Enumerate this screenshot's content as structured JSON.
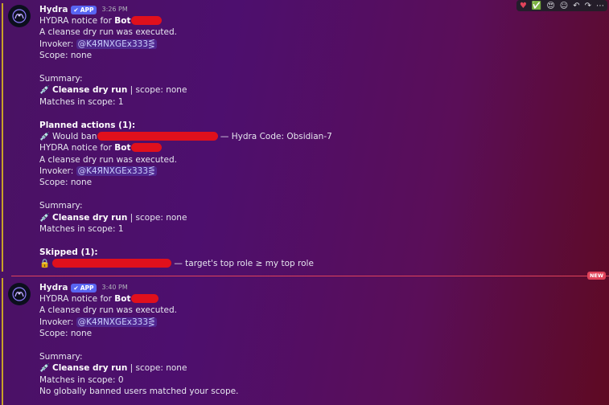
{
  "toolbar": {
    "icons": [
      "heart-icon",
      "check-icon",
      "heart-eyes-icon",
      "add-reaction-icon",
      "reply-icon",
      "forward-icon",
      "more-icon"
    ],
    "glyphs": [
      "♥",
      "✅",
      "😍",
      "☺",
      "↶",
      "↷",
      "⋯"
    ]
  },
  "messages": [
    {
      "author": "Hydra",
      "app_tag": "APP",
      "timestamp": "3:26 PM",
      "lines": {
        "notice": "HYDRA notice for ",
        "bot": "Bot",
        "executed": "A cleanse dry run was executed.",
        "invoker_label": "Invoker: ",
        "invoker": "@K4ЯNXGEx333⋚",
        "scope": "Scope: none",
        "summary": "Summary:",
        "run_bold": "Cleanse dry run",
        "run_rest": " | scope: none",
        "matches": "Matches in scope: 1",
        "planned": "Planned actions (1):",
        "would_ban": "Would ban",
        "hydra_code": " — Hydra Code: Obsidian-7",
        "skipped": "Skipped (1):",
        "skip_reason": " — target's top role ≥ my top role"
      }
    },
    {
      "author": "Hydra",
      "app_tag": "APP",
      "timestamp": "3:40 PM",
      "lines": {
        "notice": "HYDRA notice for ",
        "bot": "Bot",
        "executed": "A cleanse dry run was executed.",
        "invoker_label": "Invoker: ",
        "invoker": "@K4ЯNXGEx333⋚",
        "scope": "Scope: none",
        "summary": "Summary:",
        "run_bold": "Cleanse dry run",
        "run_rest": " | scope: none",
        "matches": "Matches in scope: 0",
        "none_found": "No globally banned users matched your scope."
      }
    }
  ],
  "divider_badge": "NEW",
  "colors": {
    "app_tag": "#5865f2",
    "redaction": "#e0101c",
    "new_divider": "#e0435a",
    "mention_text": "#c9cdfb"
  }
}
